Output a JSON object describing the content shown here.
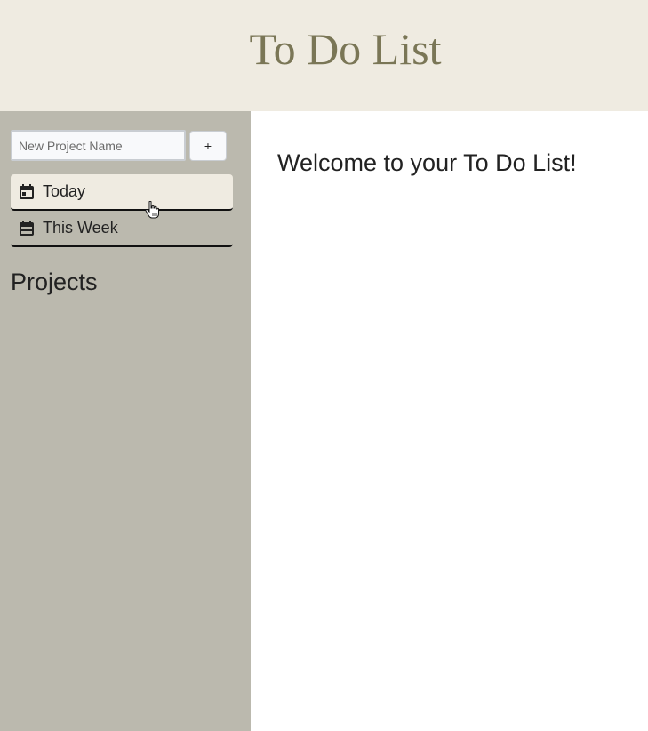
{
  "header": {
    "title": "To Do List"
  },
  "sidebar": {
    "new_project": {
      "placeholder": "New Project Name",
      "value": "",
      "add_label": "+"
    },
    "nav_items": [
      {
        "label": "Today",
        "icon": "calendar-icon",
        "active": true
      },
      {
        "label": "This Week",
        "icon": "calendar-icon",
        "active": false
      }
    ],
    "projects_heading": "Projects"
  },
  "main": {
    "welcome": "Welcome to your To Do List!"
  },
  "colors": {
    "header_bg": "#efebe1",
    "title_color": "#7a7656",
    "sidebar_bg": "#bbb9ae",
    "active_item_bg": "#efebe1"
  }
}
